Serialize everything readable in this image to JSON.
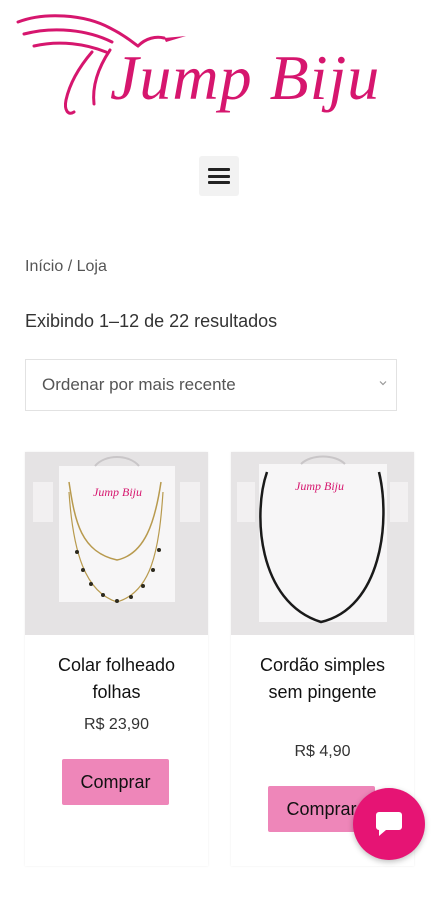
{
  "brand": {
    "name": "Jump Biju",
    "color": "#d6166e"
  },
  "header": {
    "menu_icon": "hamburger-menu-icon"
  },
  "breadcrumb": {
    "home": "Início",
    "separator": " / ",
    "current": "Loja"
  },
  "results_text": "Exibindo 1–12 de 22 resultados",
  "sort": {
    "selected": "Ordenar por mais recente",
    "icon": "chevron-down-icon"
  },
  "products": [
    {
      "title": "Colar folheado folhas",
      "price": "R$ 23,90",
      "button": "Comprar"
    },
    {
      "title": "Cordão simples sem pingente",
      "price": "R$ 4,90",
      "button": "Comprar"
    }
  ],
  "chat": {
    "icon": "chat-bubble-icon",
    "color": "#e61474"
  },
  "colors": {
    "button_bg": "#ee86b9",
    "accent": "#d6166e"
  }
}
